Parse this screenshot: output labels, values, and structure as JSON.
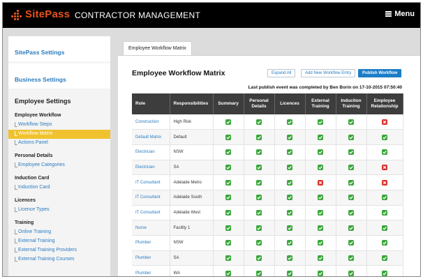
{
  "header": {
    "logo_text": "SitePass",
    "app_title": "CONTRACTOR MANAGEMENT",
    "menu_label": "Menu"
  },
  "sidebar": {
    "cards": [
      "SitePass Settings",
      "Business Settings"
    ],
    "section_title": "Employee Settings",
    "groups": [
      {
        "title": "Employee Workflow",
        "links": [
          "Workflow Steps",
          "Workflow Matrix",
          "Actions Panel"
        ]
      },
      {
        "title": "Personal Details",
        "links": [
          "Employee Categories"
        ]
      },
      {
        "title": "Induction Card",
        "links": [
          "Induction Card"
        ]
      },
      {
        "title": "Licences",
        "links": [
          "Licence Types"
        ]
      },
      {
        "title": "Training",
        "links": [
          "Online Training",
          "External Training",
          "External Training Providers",
          "External Training Courses"
        ]
      }
    ],
    "active_link": "Workflow Matrix"
  },
  "tab": {
    "label": "Employee Workflow Matrix"
  },
  "panel": {
    "title": "Employee Workflow Matrix",
    "buttons": {
      "expand": "Expand All",
      "add": "Add New Workflow Entry",
      "publish": "Publish Workflow"
    },
    "publish_note": "Last publish event was completed by Ben Borin on 17-10-2015 07:50:40"
  },
  "matrix": {
    "columns": [
      "Role",
      "Responsibilities",
      "Summary",
      "Personal Details",
      "Licences",
      "External Training",
      "Induction Training",
      "Employee Relationship"
    ],
    "rows": [
      {
        "role": "Construction",
        "resp": "High Risk",
        "cells": [
          1,
          1,
          1,
          1,
          1,
          0
        ]
      },
      {
        "role": "Default Matrix",
        "resp": "Default",
        "cells": [
          1,
          1,
          1,
          1,
          1,
          1
        ]
      },
      {
        "role": "Electrician",
        "resp": "NSW",
        "cells": [
          1,
          1,
          1,
          1,
          1,
          1
        ]
      },
      {
        "role": "Electrician",
        "resp": "SA",
        "cells": [
          1,
          1,
          1,
          1,
          1,
          0
        ]
      },
      {
        "role": "IT Consultant",
        "resp": "Adelaide Metro",
        "cells": [
          1,
          1,
          1,
          0,
          1,
          0
        ]
      },
      {
        "role": "IT Consultant",
        "resp": "Adelaide South",
        "cells": [
          1,
          1,
          1,
          1,
          1,
          1
        ]
      },
      {
        "role": "IT Consultant",
        "resp": "Adelaide West",
        "cells": [
          1,
          1,
          1,
          1,
          1,
          1
        ]
      },
      {
        "role": "Nurse",
        "resp": "Facility 1",
        "cells": [
          1,
          1,
          1,
          1,
          1,
          1
        ]
      },
      {
        "role": "Plumber",
        "resp": "NSW",
        "cells": [
          1,
          1,
          1,
          1,
          1,
          1
        ]
      },
      {
        "role": "Plumber",
        "resp": "SA",
        "cells": [
          1,
          1,
          1,
          1,
          1,
          1
        ]
      },
      {
        "role": "Plumber",
        "resp": "WA",
        "cells": [
          1,
          1,
          1,
          1,
          1,
          1
        ]
      }
    ]
  },
  "colors": {
    "brand": "#e8531e",
    "link": "#2a7bbf",
    "active": "#f0c22e",
    "ok": "#3aa63a",
    "no": "#d9312b",
    "header_bg": "#3d3d3d"
  }
}
